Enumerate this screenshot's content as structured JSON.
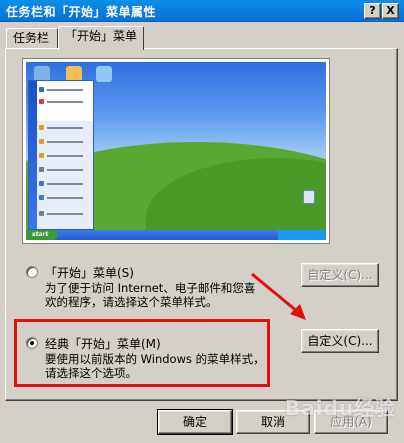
{
  "window": {
    "title": "任务栏和「开始」菜单属性",
    "help_label": "?",
    "close_label": "X"
  },
  "tabs": [
    {
      "label": "任务栏",
      "active": false
    },
    {
      "label": "「开始」菜单",
      "active": true
    }
  ],
  "preview": {
    "start_label": "start"
  },
  "options": [
    {
      "title": "「开始」菜单(S)",
      "checked": false,
      "description": [
        "为了便于访问 Internet、电子邮件和您喜",
        "欢的程序，请选择这个菜单样式。"
      ],
      "customize_label": "自定义(C)...",
      "customize_enabled": false
    },
    {
      "title": "经典「开始」菜单(M)",
      "checked": true,
      "description": [
        "要使用以前版本的 Windows 的菜单样式，",
        "请选择这个选项。"
      ],
      "customize_label": "自定义(C)...",
      "customize_enabled": true
    }
  ],
  "footer": {
    "ok_label": "确定",
    "cancel_label": "取消",
    "apply_label": "应用(A)"
  },
  "watermark": "Baidu经验",
  "colors": {
    "highlight": "#e01010",
    "titlebar": "#0a6fd9"
  }
}
